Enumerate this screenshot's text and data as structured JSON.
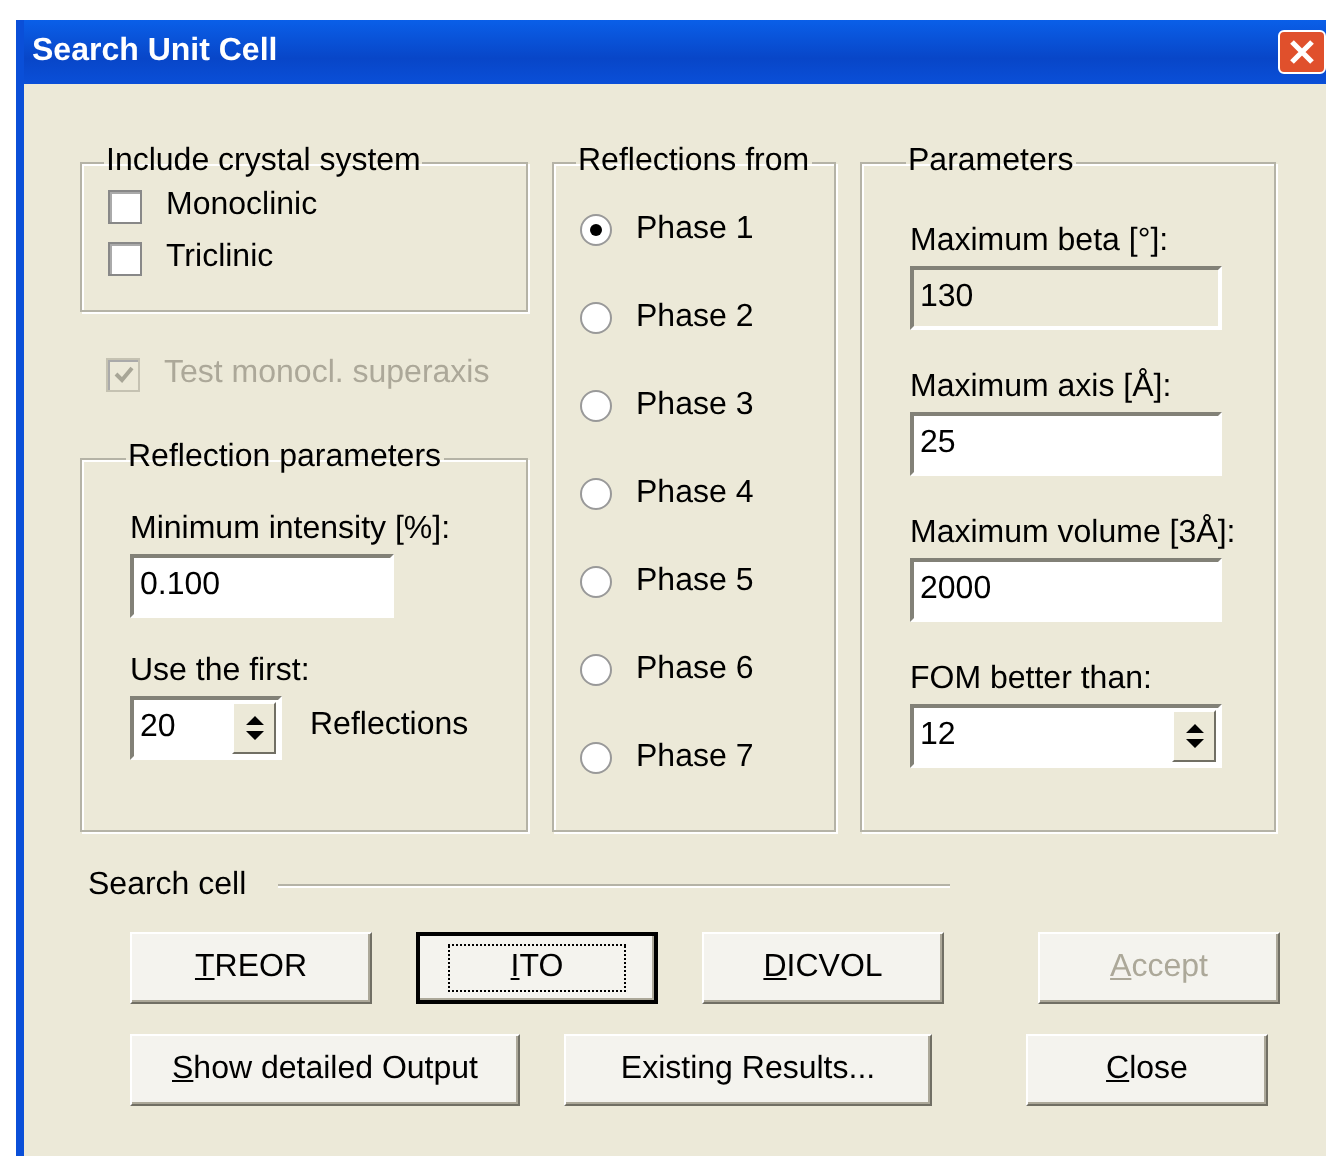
{
  "window": {
    "title": "Search Unit Cell"
  },
  "crystal_system": {
    "title": "Include crystal system",
    "options": [
      {
        "label": "Monoclinic",
        "checked": false
      },
      {
        "label": "Triclinic",
        "checked": false
      }
    ]
  },
  "superaxis": {
    "label": "Test monocl. superaxis",
    "checked": true,
    "disabled": true
  },
  "reflection_parameters": {
    "title": "Reflection parameters",
    "fields": [
      {
        "kind": "text",
        "label": "Minimum intensity [%]:",
        "value": "0.100"
      },
      {
        "kind": "spin",
        "label": "Use the first:",
        "value": "20",
        "suffix": "Reflections"
      }
    ]
  },
  "reflections_from": {
    "title": "Reflections from",
    "phases": [
      {
        "label": "Phase 1",
        "selected": true
      },
      {
        "label": "Phase 2",
        "selected": false
      },
      {
        "label": "Phase 3",
        "selected": false
      },
      {
        "label": "Phase 4",
        "selected": false
      },
      {
        "label": "Phase 5",
        "selected": false
      },
      {
        "label": "Phase 6",
        "selected": false
      },
      {
        "label": "Phase 7",
        "selected": false
      }
    ]
  },
  "parameters": {
    "title": "Parameters",
    "fields": [
      {
        "kind": "text",
        "label": "Maximum beta [°]:",
        "value": "130",
        "disabled": true
      },
      {
        "kind": "text",
        "label": "Maximum axis [Å]:",
        "value": "25"
      },
      {
        "kind": "text",
        "label": "Maximum volume [3Å]:",
        "value": "2000"
      },
      {
        "kind": "spin",
        "label": "FOM better than:",
        "value": "12"
      }
    ]
  },
  "search_cell": {
    "title": "Search cell"
  },
  "button_rows": [
    [
      {
        "label": "TREOR",
        "access_key": true,
        "default": false,
        "disabled": false
      },
      {
        "label": "ITO",
        "access_key": true,
        "default": true,
        "disabled": false
      },
      {
        "label": "DICVOL",
        "access_key": true,
        "default": false,
        "disabled": false
      },
      {
        "label": "Accept",
        "access_key": true,
        "default": false,
        "disabled": true
      }
    ],
    [
      {
        "label": "Show detailed Output",
        "access_key": true,
        "default": false,
        "disabled": false
      },
      {
        "label": "Existing Results...",
        "access_key": false,
        "default": false,
        "disabled": false
      },
      {
        "label": "Close",
        "access_key": true,
        "default": false,
        "disabled": false
      }
    ]
  ]
}
